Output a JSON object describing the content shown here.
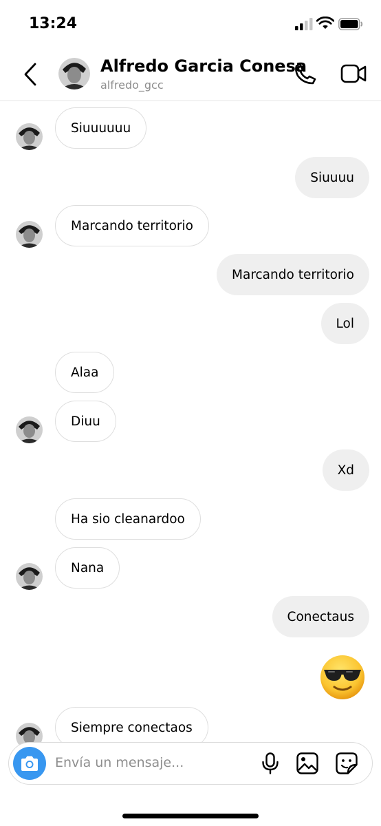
{
  "status_bar": {
    "time": "13:24"
  },
  "header": {
    "name": "Alfredo Garcia Conesa",
    "username": "alfredo_gcc"
  },
  "messages": [
    {
      "text": "Siuuuuuu",
      "direction": "in"
    },
    {
      "text": "Siuuuu",
      "direction": "out"
    },
    {
      "text": "Marcando territorio",
      "direction": "in"
    },
    {
      "text": "Marcando territorio",
      "direction": "out"
    },
    {
      "text": "Lol",
      "direction": "out"
    },
    {
      "text": "Alaa",
      "direction": "in"
    },
    {
      "text": "Diuu",
      "direction": "in"
    },
    {
      "text": "Xd",
      "direction": "out"
    },
    {
      "text": "Ha sio cleanardoo",
      "direction": "in"
    },
    {
      "text": "Nana",
      "direction": "in"
    },
    {
      "text": "Conectaus",
      "direction": "out"
    },
    {
      "emoji": "smiling-face-with-sunglasses",
      "direction": "out"
    },
    {
      "text": "Siempre conectaos",
      "direction": "in"
    }
  ],
  "composer": {
    "placeholder": "Envía un mensaje..."
  },
  "colors": {
    "incoming_border": "#dedede",
    "outgoing_bg": "#efefef",
    "camera_button": "#3897f0",
    "muted_text": "#8e8e8e"
  }
}
